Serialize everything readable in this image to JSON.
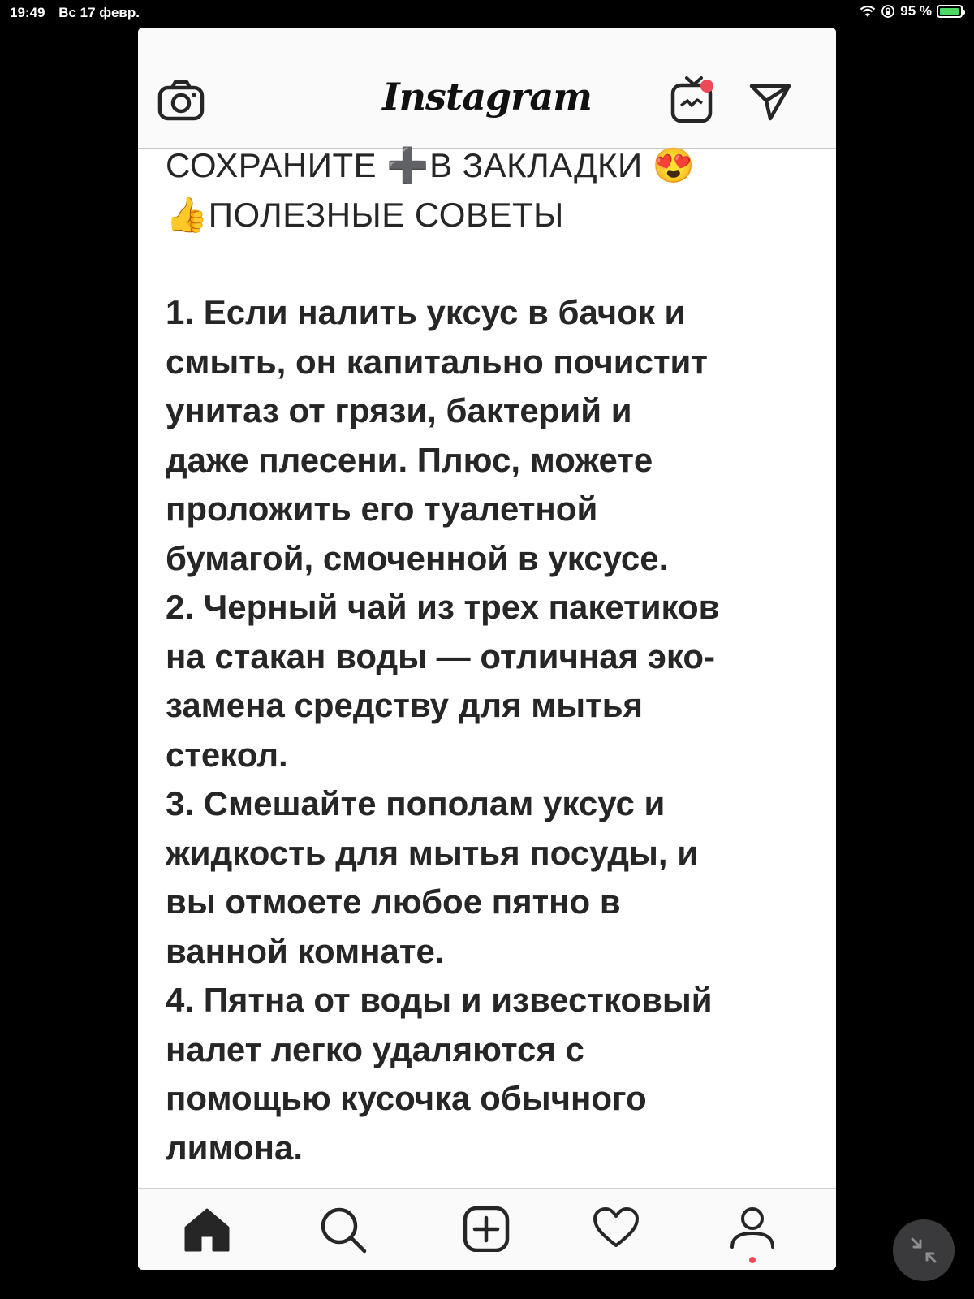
{
  "status_bar": {
    "time": "19:49",
    "date": "Вс 17 февр.",
    "battery_text": "95 %",
    "battery_level": 0.95
  },
  "header": {
    "logo": "Instagram",
    "icons": [
      "camera-icon",
      "igtv-icon",
      "direct-message-icon"
    ],
    "notification_color": "#ed4956"
  },
  "post": {
    "headline_1": "СОХРАНИТЕ ➕В ЗАКЛАДКИ 😍",
    "headline_2": "👍ПОЛЕЗНЫЕ СОВЕТЫ",
    "body_lines": [
      "1. Если налить уксус в бачок и",
      "смыть, он капитально почистит",
      "унитаз от грязи, бактерий и",
      "даже плесени. Плюс, можете",
      "проложить его туалетной",
      "бумагой, смоченной в уксусе.",
      "2. Черный чай из трех пакетиков",
      "на стакан воды — отличная эко-",
      "замена средству для мытья",
      "стекол.",
      "3. Смешайте пополам уксус и",
      "жидкость для мытья посуды, и",
      "вы отмоете любое пятно в",
      "ванной комнате.",
      "4. Пятна от воды и известковый",
      "налет легко удаляются с",
      "помощью кусочка обычного",
      "лимона."
    ]
  },
  "tab_bar": {
    "icons": [
      "home-icon",
      "search-icon",
      "new-post-icon",
      "activity-heart-icon",
      "profile-icon"
    ]
  }
}
